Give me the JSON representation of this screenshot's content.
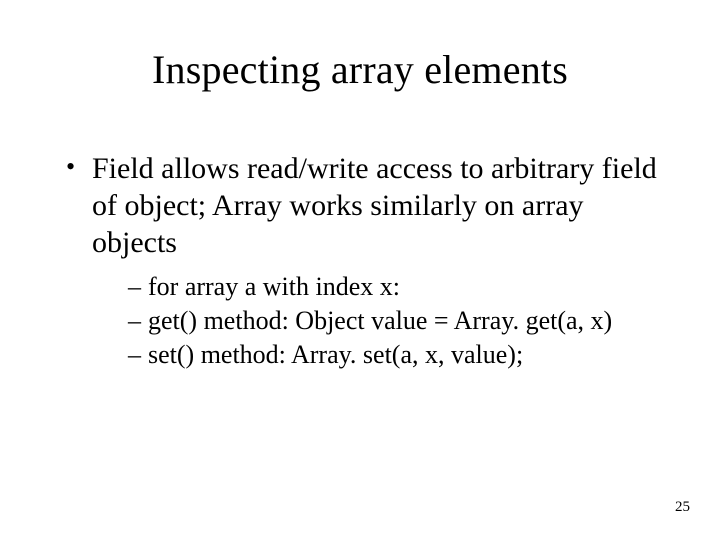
{
  "title": "Inspecting array elements",
  "bullet": "Field allows read/write access to arbitrary field of object; Array works similarly on array objects",
  "subitems": [
    "for array a with index x:",
    "get() method: Object value = Array. get(a, x)",
    "set() method: Array. set(a, x, value);"
  ],
  "page_number": "25"
}
